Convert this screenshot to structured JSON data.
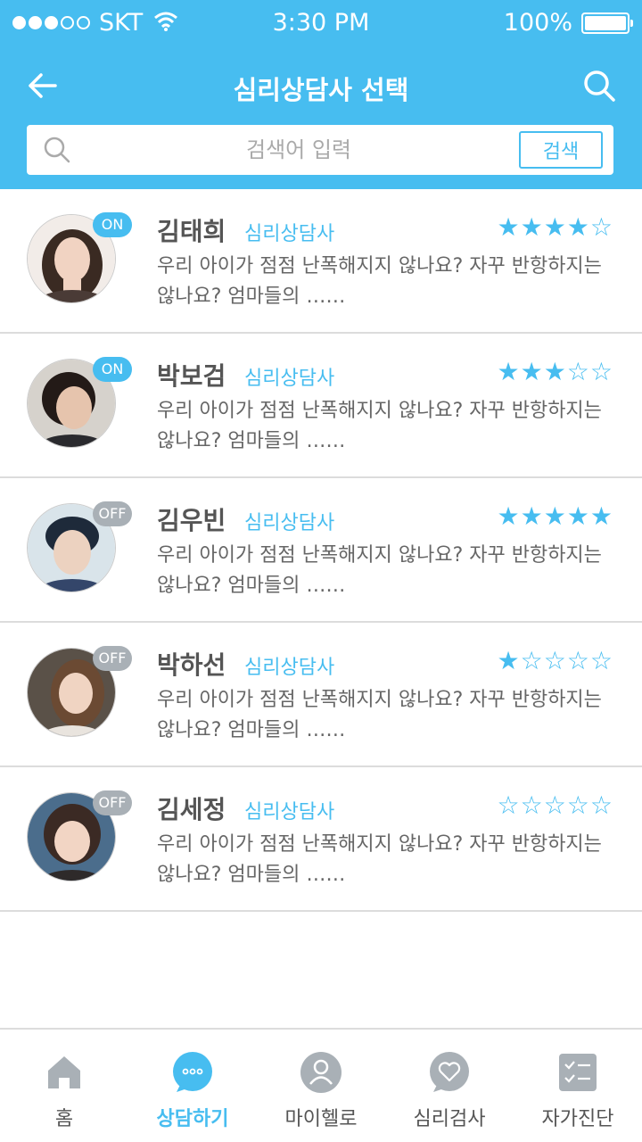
{
  "status": {
    "carrier": "SKT",
    "time": "3:30 PM",
    "battery": "100%"
  },
  "header": {
    "title": "심리상담사 선택"
  },
  "search": {
    "placeholder": "검색어 입력",
    "button": "검색"
  },
  "counselors": [
    {
      "name": "김태희",
      "role": "심리상담사",
      "status": "ON",
      "rating": 4,
      "stars": "★★★★☆",
      "desc": "우리 아이가 점점 난폭해지지 않나요? 자꾸 반항하지는 않나요? 엄마들의 ……"
    },
    {
      "name": "박보검",
      "role": "심리상담사",
      "status": "ON",
      "rating": 3,
      "stars": "★★★☆☆",
      "desc": "우리 아이가 점점 난폭해지지 않나요? 자꾸 반항하지는 않나요? 엄마들의 ……"
    },
    {
      "name": "김우빈",
      "role": "심리상담사",
      "status": "OFF",
      "rating": 5,
      "stars": "★★★★★",
      "desc": "우리 아이가 점점 난폭해지지 않나요? 자꾸 반항하지는 않나요? 엄마들의 ……"
    },
    {
      "name": "박하선",
      "role": "심리상담사",
      "status": "OFF",
      "rating": 1,
      "stars": "★☆☆☆☆",
      "desc": "우리 아이가 점점 난폭해지지 않나요? 자꾸 반항하지는 않나요? 엄마들의 ……"
    },
    {
      "name": "김세정",
      "role": "심리상담사",
      "status": "OFF",
      "rating": 0,
      "stars": "☆☆☆☆☆",
      "desc": "우리 아이가 점점 난폭해지지 않나요? 자꾸 반항하지는 않나요? 엄마들의 ……"
    }
  ],
  "tabs": [
    {
      "label": "홈",
      "icon": "home-icon"
    },
    {
      "label": "상담하기",
      "icon": "chat-icon",
      "active": true
    },
    {
      "label": "마이헬로",
      "icon": "user-icon"
    },
    {
      "label": "심리검사",
      "icon": "heart-chat-icon"
    },
    {
      "label": "자가진단",
      "icon": "checklist-icon"
    }
  ],
  "colors": {
    "accent": "#47bdf0",
    "off_badge": "#a9b0b6",
    "tab_gray": "#a9b0b6"
  }
}
